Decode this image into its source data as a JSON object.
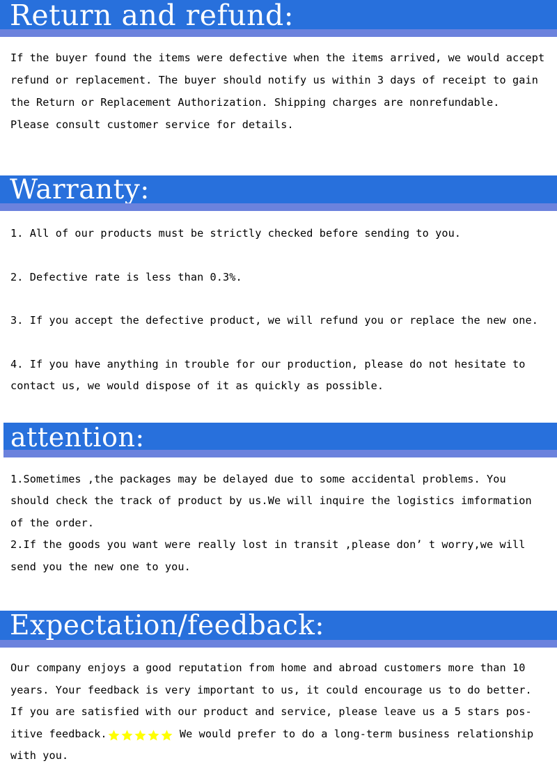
{
  "colors": {
    "banner_blue": "#2870dc",
    "banner_underline": "#6b82dd",
    "banner_text": "#ffffff",
    "body_text": "#000000",
    "star_yellow": "#ffff00"
  },
  "sections": {
    "return": {
      "title": "Return and refund:",
      "lines": [
        "If the buyer found the items were defective when the items arrived, we would accept",
        "refund or replacement. The buyer should notify us within 3 days of receipt to gain",
        "the Return or Replacement Authorization. Shipping charges are nonrefundable.",
        "Please consult customer service for details."
      ]
    },
    "warranty": {
      "title": "Warranty:",
      "items": [
        "1. All of our products must be strictly checked before sending to you.",
        "2. Defective rate is less than 0.3%.",
        "3. If you accept the defective product, we will refund you or replace the new one.",
        "4. If you have anything in trouble for our production, please do not hesitate to",
        "contact us, we would dispose of it as quickly as possible."
      ]
    },
    "attention": {
      "title": "attention:",
      "lines": [
        "1.Sometimes ,the packages may be delayed due to some accidental problems. You",
        "should check the track of product by us.We will inquire the logistics imformation",
        "of the order.",
        "2.If the goods you want were really lost in transit ,please don’ t worry,we will",
        "send you the new one to you."
      ]
    },
    "expectation": {
      "title": "Expectation/feedback:",
      "lines": [
        "Our company enjoys a good reputation from home and abroad customers more than 10",
        "years. Your feedback is very important to us, it could encourage us to do better.",
        "If you are satisfied with our product and service, please leave us a 5 stars pos-"
      ],
      "star_line_before": "itive feedback.",
      "star_line_after": " We would prefer to do a long-term business relationship",
      "last_line": "with you.",
      "star_count": 5,
      "star_icon": "star-icon"
    }
  }
}
